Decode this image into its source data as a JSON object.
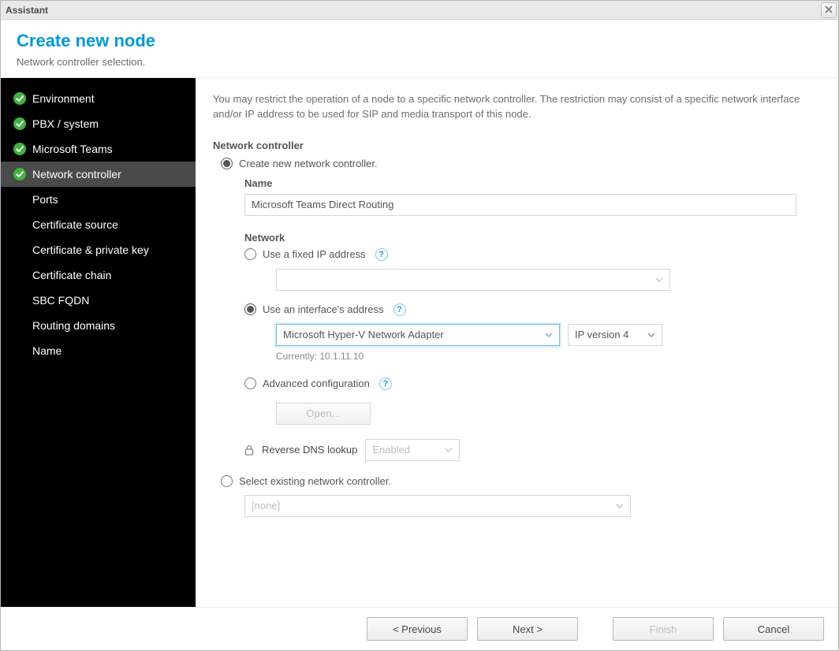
{
  "window": {
    "title": "Assistant"
  },
  "header": {
    "title": "Create new node",
    "subtitle": "Network controller selection."
  },
  "sidebar": {
    "items": [
      {
        "label": "Environment",
        "done": true,
        "child": false
      },
      {
        "label": "PBX / system",
        "done": true,
        "child": false
      },
      {
        "label": "Microsoft Teams",
        "done": true,
        "child": false
      },
      {
        "label": "Network controller",
        "done": true,
        "child": false,
        "active": true
      },
      {
        "label": "Ports",
        "done": false,
        "child": true
      },
      {
        "label": "Certificate source",
        "done": false,
        "child": true
      },
      {
        "label": "Certificate & private key",
        "done": false,
        "child": true
      },
      {
        "label": "Certificate chain",
        "done": false,
        "child": true
      },
      {
        "label": "SBC FQDN",
        "done": false,
        "child": true
      },
      {
        "label": "Routing domains",
        "done": false,
        "child": true
      },
      {
        "label": "Name",
        "done": false,
        "child": true
      }
    ]
  },
  "main": {
    "intro": "You may restrict the operation of a node to a specific network controller. The restriction may consist of a specific network interface and/or IP address to be used for SIP and media transport of this node.",
    "section_title": "Network controller",
    "create_label": "Create new network controller.",
    "name_label": "Name",
    "name_value": "Microsoft Teams Direct Routing",
    "network_label": "Network",
    "fixed_ip_label": "Use a fixed IP address",
    "fixed_ip_selected": "",
    "interface_label": "Use an interface's address",
    "interface_adapter": "Microsoft Hyper-V Network Adapter",
    "ip_version": "IP version 4",
    "currently_prefix": "Currently: ",
    "currently_value": "10.1.11.10",
    "advanced_label": "Advanced configuration",
    "open_label": "Open...",
    "reverse_dns_label": "Reverse DNS lookup",
    "reverse_dns_value": "Enabled",
    "select_existing_label": "Select existing network controller.",
    "existing_value": "[none]"
  },
  "footer": {
    "previous": "< Previous",
    "next": "Next >",
    "finish": "Finish",
    "cancel": "Cancel"
  }
}
